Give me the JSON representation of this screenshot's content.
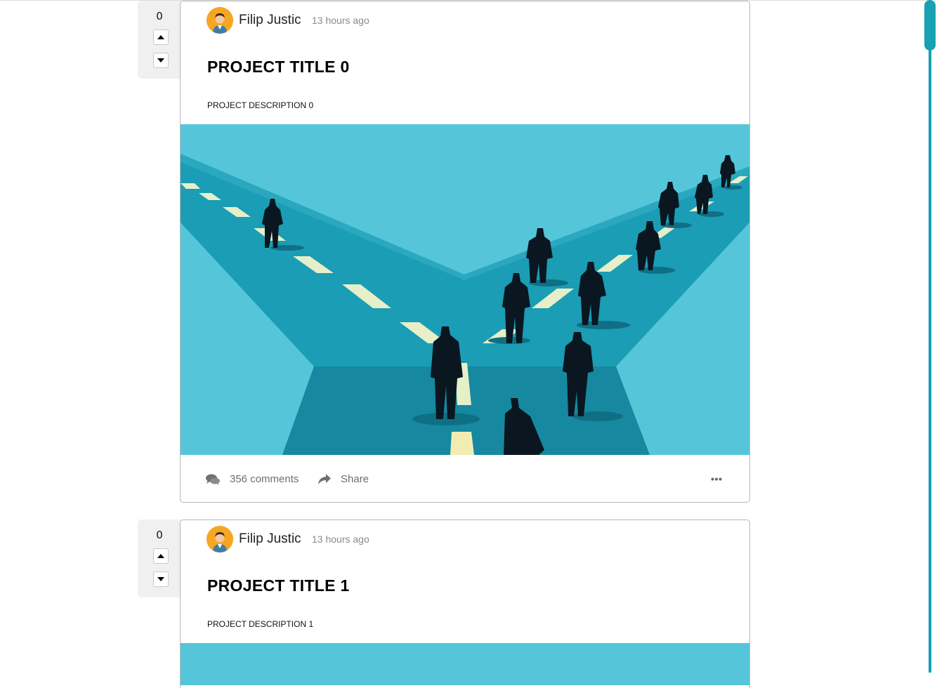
{
  "posts": [
    {
      "votes": "0",
      "author": "Filip Justic",
      "time": "13 hours ago",
      "title": "PROJECT TITLE 0",
      "description": "PROJECT DESCRIPTION 0",
      "comments": "356 comments",
      "share": "Share"
    },
    {
      "votes": "0",
      "author": "Filip Justic",
      "time": "13 hours ago",
      "title": "PROJECT TITLE 1",
      "description": "PROJECT DESCRIPTION 1",
      "comments": "",
      "share": ""
    }
  ],
  "icons": {
    "upvote": "caret-up-icon",
    "downvote": "caret-down-icon",
    "comments": "comments-icon",
    "share": "share-icon",
    "more": "ellipsis-icon",
    "avatar": "user-avatar"
  },
  "colors": {
    "accent": "#18a0b3",
    "avatar_bg": "#f5a623",
    "image_bg": "#55c6da",
    "road": "#1a9db5"
  }
}
